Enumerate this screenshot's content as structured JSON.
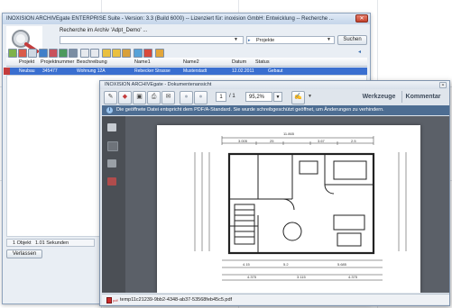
{
  "main_window": {
    "title": "INOXISION ARCHIVEgate ENTERPRISE Suite - Version: 3.3 (Build 6000) -- Lizenziert für: inoxision GmbH: Entwicklung -- Recherche ...",
    "close_glyph": "✕",
    "recherche_label": "Recherche im Archiv 'Adpt_Demo' ...",
    "search_value": "",
    "scope_value": "Projekte",
    "search_button": "Suchen",
    "columns": [
      "Projekt",
      "Projektnummer",
      "Beschreibung",
      "Name1",
      "Name2",
      "Datum",
      "Status"
    ],
    "selected_row": [
      "Neubau",
      "345477",
      "Wohnung 12A",
      "Rebecker Strasse",
      "Musterstadt",
      "12.02.2011",
      "Gebaut"
    ],
    "status_text": "1 Objekt",
    "status_time": "1.01 Sekunden",
    "close_button": "Verlassen"
  },
  "viewer": {
    "title": "INOXISION ARCHIVEgate - Dokumentenansicht",
    "close_glyph": "✕",
    "page_current": "1",
    "page_total": "/ 1",
    "zoom": "95,2%",
    "tools_label": "Werkzeuge",
    "comment_label": "Kommentar",
    "info_icon": "i",
    "info_text": "Die geöffnete Datei entspricht dem PDF/A-Standard. Sie wurde schreibgeschützt geöffnet, um Änderungen zu verhindern.",
    "file_name": "temp11c21239-9bb2-4348-ab37-53568feb45c5.pdf",
    "file_badge": "pdf"
  },
  "colors": {
    "accent": "#3a6fd0",
    "info_bar": "#4d6d92",
    "doc_bg": "#5b6068"
  },
  "icons": [
    "logo-icon",
    "back-icon",
    "forward-icon",
    "print-icon",
    "save-icon",
    "email-icon",
    "search-icon",
    "folder-icon",
    "prev-page-icon",
    "next-page-icon",
    "sign-icon",
    "pdf-icon",
    "info-icon"
  ]
}
